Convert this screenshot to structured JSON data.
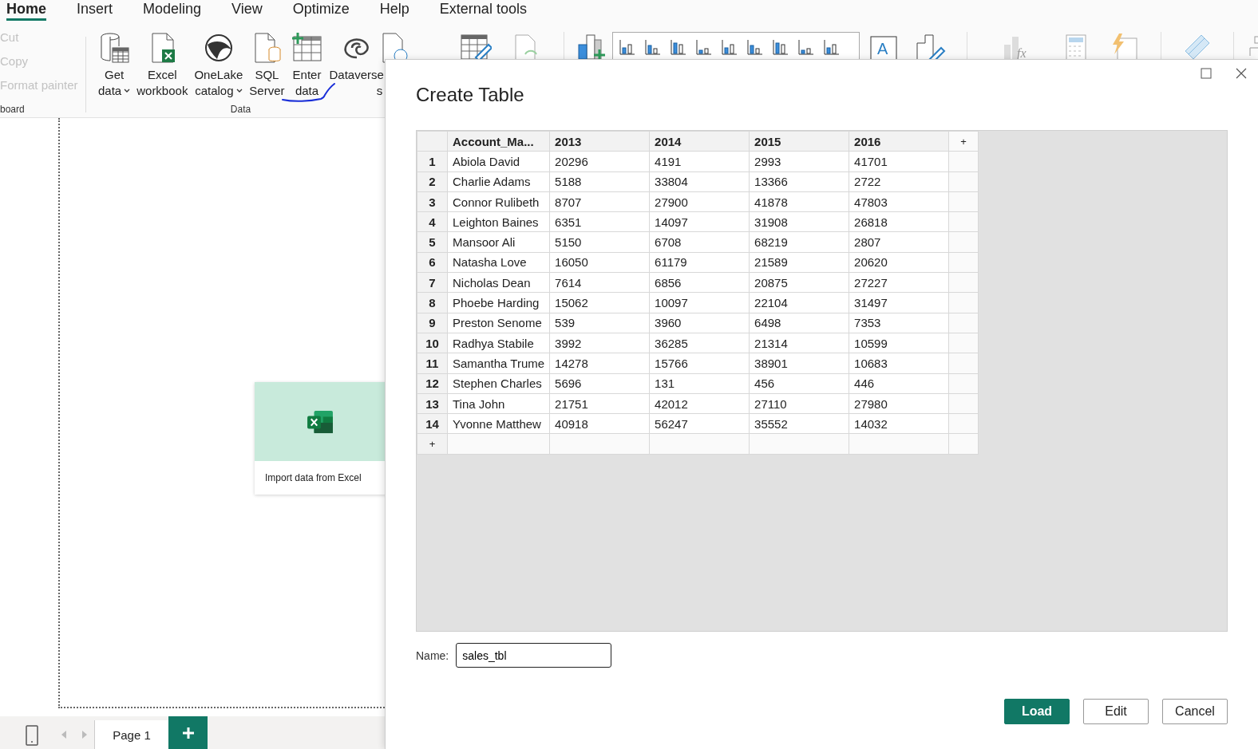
{
  "menu_tabs": [
    {
      "label": "Home",
      "selected": true
    },
    {
      "label": "Insert",
      "selected": false
    },
    {
      "label": "Modeling",
      "selected": false
    },
    {
      "label": "View",
      "selected": false
    },
    {
      "label": "Optimize",
      "selected": false
    },
    {
      "label": "Help",
      "selected": false
    },
    {
      "label": "External tools",
      "selected": false
    }
  ],
  "ribbon": {
    "clipboard": {
      "items": [
        {
          "label": "Cut",
          "disabled": true
        },
        {
          "label": "Copy",
          "disabled": true
        },
        {
          "label": "Format painter",
          "disabled": true
        }
      ],
      "group_label": "board"
    },
    "data": {
      "buttons": [
        {
          "lines": [
            "Get",
            "data"
          ],
          "dropdown": true
        },
        {
          "lines": [
            "Excel",
            "workbook"
          ],
          "dropdown": false
        },
        {
          "lines": [
            "OneLake",
            "catalog"
          ],
          "dropdown": true
        },
        {
          "lines": [
            "SQL",
            "Server"
          ],
          "dropdown": false
        },
        {
          "lines": [
            "Enter",
            "data"
          ],
          "dropdown": false
        },
        {
          "lines": [
            "Dataverse"
          ],
          "dropdown": false
        }
      ],
      "partial_label": "s",
      "group_label": "Data"
    },
    "text_box_glyph": "A",
    "function_glyph": "fx"
  },
  "canvas": {
    "card": {
      "label": "Import data from Excel"
    }
  },
  "page_tabs": [
    {
      "label": "Page 1",
      "selected": true
    }
  ],
  "dialog": {
    "title": "Create Table",
    "table": {
      "columns": [
        "Account_Ma...",
        "2013",
        "2014",
        "2015",
        "2016"
      ],
      "add_column": "+",
      "add_row": "+",
      "rows": [
        {
          "number": "1",
          "cells": [
            "Abiola David",
            "20296",
            "4191",
            "2993",
            "41701"
          ]
        },
        {
          "number": "2",
          "cells": [
            "Charlie Adams",
            "5188",
            "33804",
            "13366",
            "2722"
          ]
        },
        {
          "number": "3",
          "cells": [
            "Connor Rulibeth",
            "8707",
            "27900",
            "41878",
            "47803"
          ]
        },
        {
          "number": "4",
          "cells": [
            "Leighton Baines",
            "6351",
            "14097",
            "31908",
            "26818"
          ]
        },
        {
          "number": "5",
          "cells": [
            "Mansoor Ali",
            "5150",
            "6708",
            "68219",
            "2807"
          ]
        },
        {
          "number": "6",
          "cells": [
            "Natasha Love",
            "16050",
            "61179",
            "21589",
            "20620"
          ]
        },
        {
          "number": "7",
          "cells": [
            "Nicholas Dean",
            "7614",
            "6856",
            "20875",
            "27227"
          ]
        },
        {
          "number": "8",
          "cells": [
            "Phoebe Harding",
            "15062",
            "10097",
            "22104",
            "31497"
          ]
        },
        {
          "number": "9",
          "cells": [
            "Preston Senome",
            "539",
            "3960",
            "6498",
            "7353"
          ]
        },
        {
          "number": "10",
          "cells": [
            "Radhya Stabile",
            "3992",
            "36285",
            "21314",
            "10599"
          ]
        },
        {
          "number": "11",
          "cells": [
            "Samantha Trume",
            "14278",
            "15766",
            "38901",
            "10683"
          ]
        },
        {
          "number": "12",
          "cells": [
            "Stephen Charles",
            "5696",
            "131",
            "456",
            "446"
          ]
        },
        {
          "number": "13",
          "cells": [
            "Tina John",
            "21751",
            "42012",
            "27110",
            "27980"
          ]
        },
        {
          "number": "14",
          "cells": [
            "Yvonne Matthew",
            "40918",
            "56247",
            "35552",
            "14032"
          ]
        }
      ]
    },
    "name": {
      "label": "Name:",
      "value": "sales_tbl"
    },
    "buttons": [
      {
        "label": "Load",
        "primary": true
      },
      {
        "label": "Edit",
        "primary": false
      },
      {
        "label": "Cancel",
        "primary": false
      }
    ]
  }
}
